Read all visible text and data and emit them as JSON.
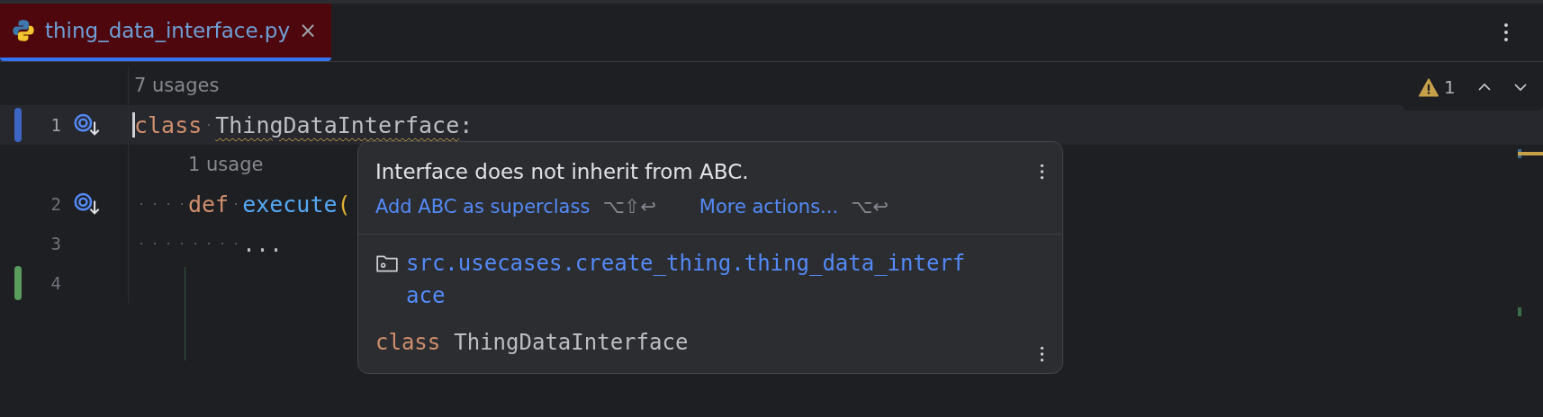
{
  "tabs": [
    {
      "label": "thing_data_interface.py",
      "selected": true,
      "close": "×"
    }
  ],
  "editor": {
    "rows": [
      {
        "kind": "hint",
        "text": "7 usages",
        "indented": false
      },
      {
        "kind": "code",
        "number": "1",
        "current": true,
        "color": "#3d65c4",
        "gutter_icon": true,
        "tokens": [
          {
            "kind": "keyword",
            "text": "class"
          },
          {
            "kind": "space"
          },
          {
            "kind": "name",
            "text": "ThingDataInterface",
            "warning": true
          },
          {
            "kind": "plain",
            "text": ":"
          }
        ]
      },
      {
        "kind": "hint",
        "text": "1 usage",
        "indented": true
      },
      {
        "kind": "code",
        "number": "2",
        "current": false,
        "gutter_icon": true,
        "tokens": [
          {
            "kind": "indent"
          },
          {
            "kind": "keyword",
            "text": "def"
          },
          {
            "kind": "space"
          },
          {
            "kind": "function",
            "text": "execute"
          },
          {
            "kind": "paren",
            "text": "("
          }
        ]
      },
      {
        "kind": "code",
        "number": "3",
        "current": false,
        "gutter_icon": false,
        "tokens": [
          {
            "kind": "indent"
          },
          {
            "kind": "indent"
          },
          {
            "kind": "plain",
            "text": "..."
          }
        ]
      },
      {
        "kind": "code",
        "number": "4",
        "current": false,
        "color": "#5a9b5e",
        "gutter_icon": false,
        "tokens": []
      }
    ]
  },
  "inspection_widget": {
    "count": "1"
  },
  "popup": {
    "message": "Interface does not inherit from ABC.",
    "actions": [
      {
        "label": "Add ABC as superclass",
        "shortcut": "⌥⇧↩"
      },
      {
        "label": "More actions...",
        "shortcut": "⌥↩"
      }
    ],
    "module": "src.usecases.create_thing.thing_data_interf",
    "module_wrap": "ace",
    "declaration": [
      {
        "kind": "keyword",
        "text": "class"
      },
      {
        "kind": "space"
      },
      {
        "kind": "plain",
        "text": "ThingDataInterface"
      }
    ]
  }
}
